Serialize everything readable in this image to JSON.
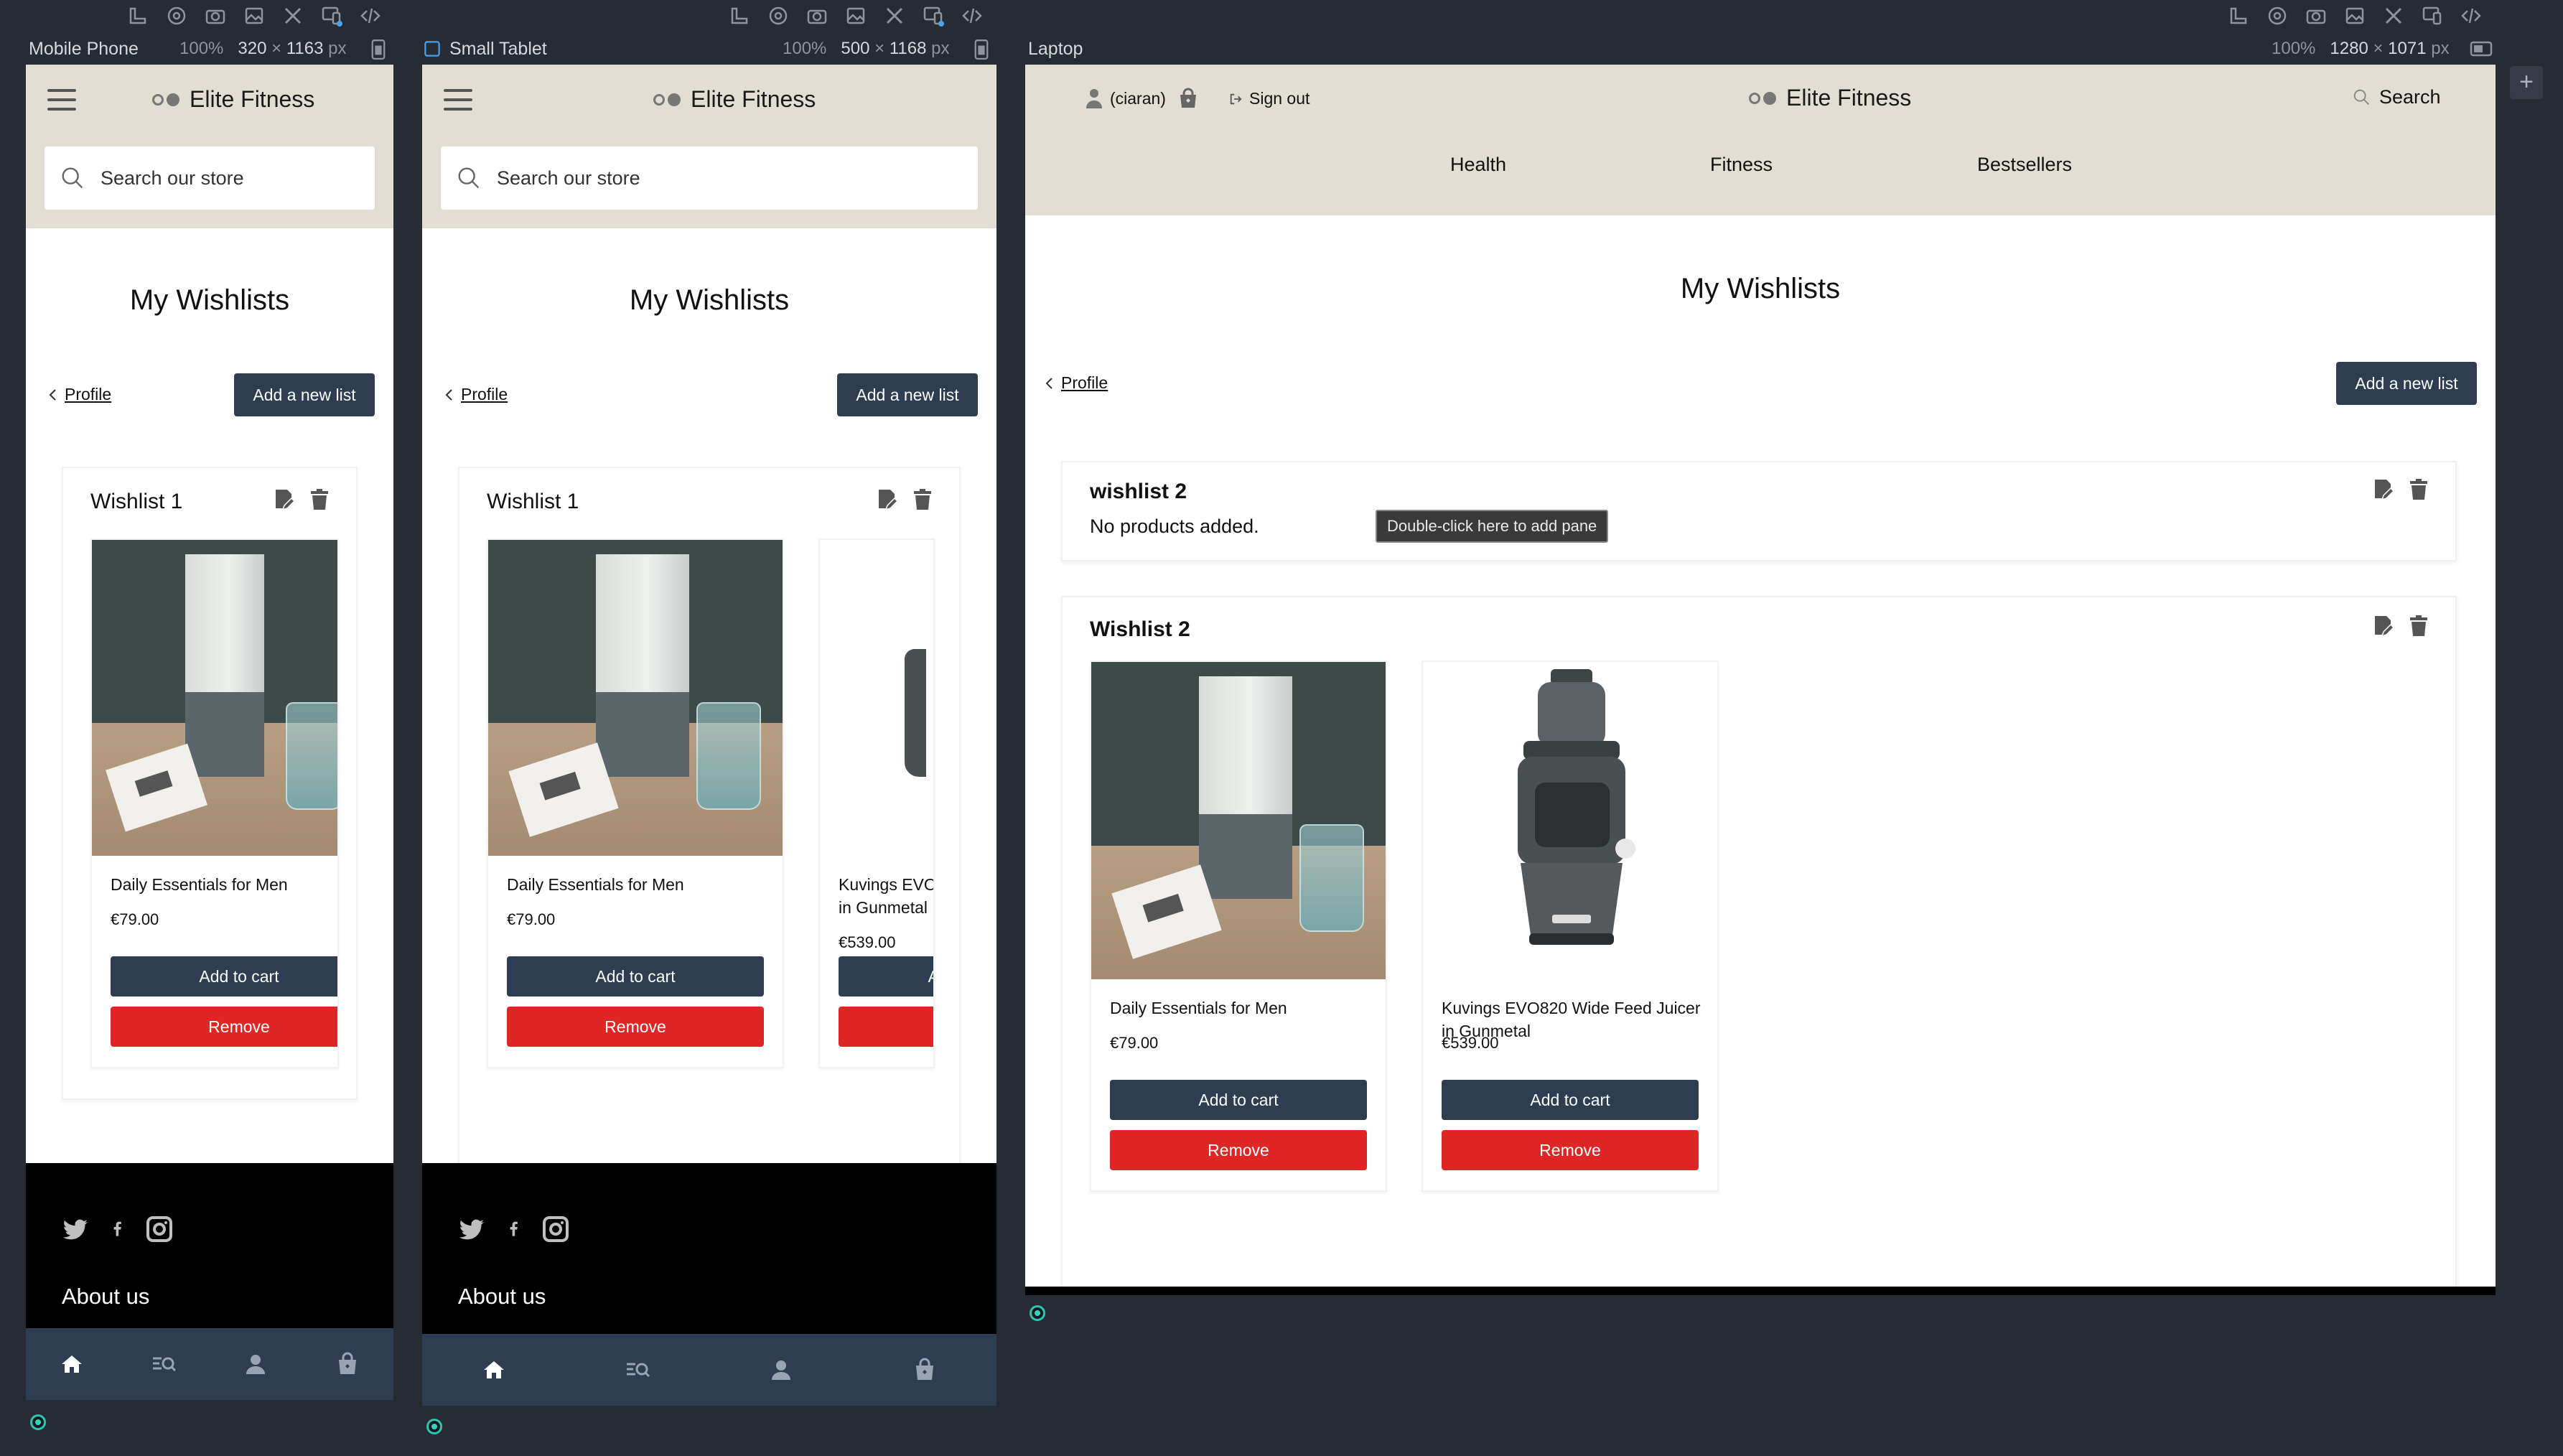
{
  "devices": [
    {
      "label": "Mobile Phone",
      "zoom": "100%",
      "width": "320",
      "height": "1163",
      "unit": "px"
    },
    {
      "label": "Small Tablet",
      "zoom": "100%",
      "width": "500",
      "height": "1168",
      "unit": "px"
    },
    {
      "label": "Laptop",
      "zoom": "100%",
      "width": "1280",
      "height": "1071",
      "unit": "px"
    }
  ],
  "store": {
    "name": "Elite Fitness",
    "search_placeholder": "Search our store",
    "user": "(ciaran)",
    "sign_out": "Sign out",
    "search_label": "Search",
    "nav": [
      "Health",
      "Fitness",
      "Bestsellers"
    ]
  },
  "page": {
    "title": "My Wishlists",
    "back_link": "Profile",
    "add_list_button": "Add a new list"
  },
  "mobile_wishlists": [
    {
      "name": "Wishlist 1"
    }
  ],
  "laptop_wishlists": [
    {
      "name": "wishlist 2",
      "empty_text": "No products added."
    },
    {
      "name": "Wishlist 2"
    }
  ],
  "products": [
    {
      "name": "Daily Essentials for Men",
      "price": "€79.00",
      "add_label": "Add to cart",
      "remove_label": "Remove"
    },
    {
      "name": "Kuvings EVO820 Wide Feed Juicer in Gunmetal",
      "price": "€539.00",
      "add_label": "Add to cart",
      "remove_label": "Remove"
    }
  ],
  "truncated": {
    "name_line1": "Kuvings EVO",
    "name_line2": "in Gunmetal",
    "add_fragment": "A"
  },
  "footer": {
    "about": "About us"
  },
  "tooltip": "Double-click here to add pane",
  "colors": {
    "header_bg": "#e2ded3",
    "primary": "#2f3d52",
    "danger": "#df2626",
    "canvas": "#262b34"
  }
}
